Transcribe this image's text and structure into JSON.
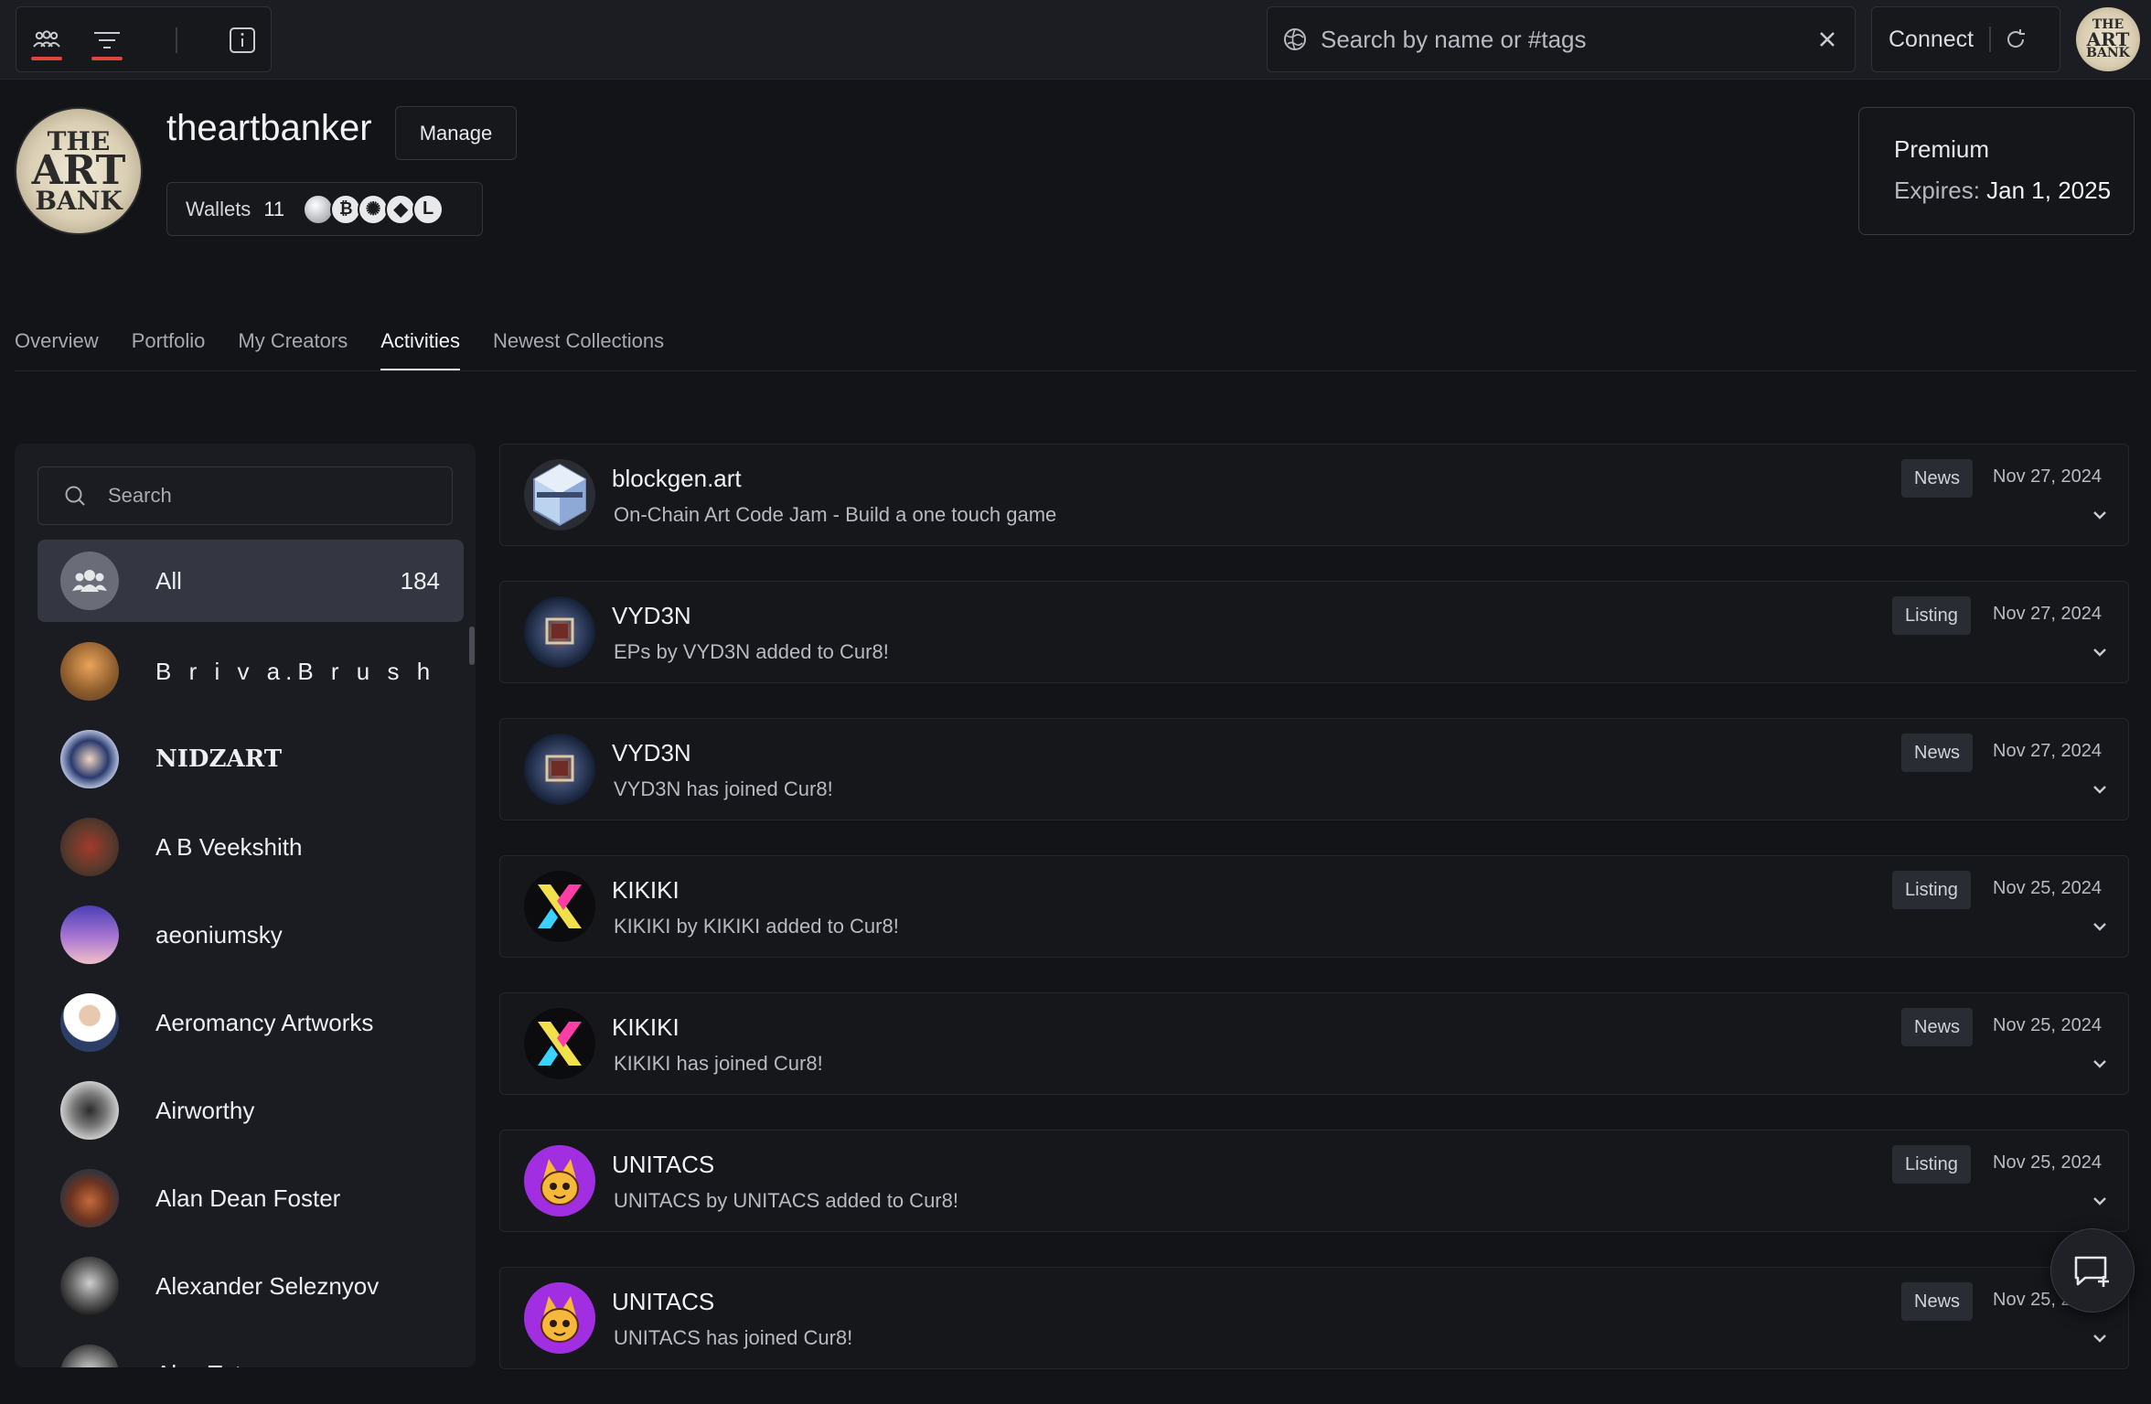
{
  "topbar": {
    "search_placeholder": "Search by name or #tags",
    "connect_label": "Connect"
  },
  "profile": {
    "name": "theartbanker",
    "manage_label": "Manage",
    "wallets_label": "Wallets",
    "wallets_count": "11",
    "logo_text": [
      "THE",
      "ART",
      "BANK"
    ],
    "chains": [
      "generic-token-icon",
      "bitcoin-icon",
      "cardano-icon",
      "ethereum-icon",
      "loopring-icon"
    ]
  },
  "premium": {
    "title": "Premium",
    "expires_label": "Expires:",
    "expires_date": "Jan 1, 2025"
  },
  "tabs": [
    {
      "label": "Overview",
      "active": false
    },
    {
      "label": "Portfolio",
      "active": false
    },
    {
      "label": "My Creators",
      "active": false
    },
    {
      "label": "Activities",
      "active": true
    },
    {
      "label": "Newest Collections",
      "active": false
    }
  ],
  "sidebar": {
    "search_placeholder": "Search",
    "all": {
      "label": "All",
      "count": "184"
    },
    "creators": [
      {
        "name": "B r i v a.B r u s h"
      },
      {
        "name": "NIDZART"
      },
      {
        "name": "A B Veekshith"
      },
      {
        "name": "aeoniumsky"
      },
      {
        "name": "Aeromancy Artworks"
      },
      {
        "name": "Airworthy"
      },
      {
        "name": "Alan Dean Foster"
      },
      {
        "name": "Alexander Seleznyov"
      },
      {
        "name": "Alex Tut"
      }
    ]
  },
  "feed": [
    {
      "title": "blockgen.art",
      "desc": "On-Chain Art Code Jam - Build a one touch game",
      "badge": "News",
      "date": "Nov 27, 2024"
    },
    {
      "title": "VYD3N",
      "desc": "EPs by VYD3N added to Cur8!",
      "badge": "Listing",
      "date": "Nov 27, 2024"
    },
    {
      "title": "VYD3N",
      "desc": "VYD3N has joined Cur8!",
      "badge": "News",
      "date": "Nov 27, 2024"
    },
    {
      "title": "KIKIKI",
      "desc": "KIKIKI by KIKIKI added to Cur8!",
      "badge": "Listing",
      "date": "Nov 25, 2024"
    },
    {
      "title": "KIKIKI",
      "desc": "KIKIKI has joined Cur8!",
      "badge": "News",
      "date": "Nov 25, 2024"
    },
    {
      "title": "UNITACS",
      "desc": "UNITACS by UNITACS added to Cur8!",
      "badge": "Listing",
      "date": "Nov 25, 2024"
    },
    {
      "title": "UNITACS",
      "desc": "UNITACS has joined Cur8!",
      "badge": "News",
      "date": "Nov 25, 2024"
    }
  ],
  "colors": {
    "background": "#131417",
    "accent_underline": "#e0463b",
    "card": "#16171b",
    "badge": "#2a2c33"
  }
}
